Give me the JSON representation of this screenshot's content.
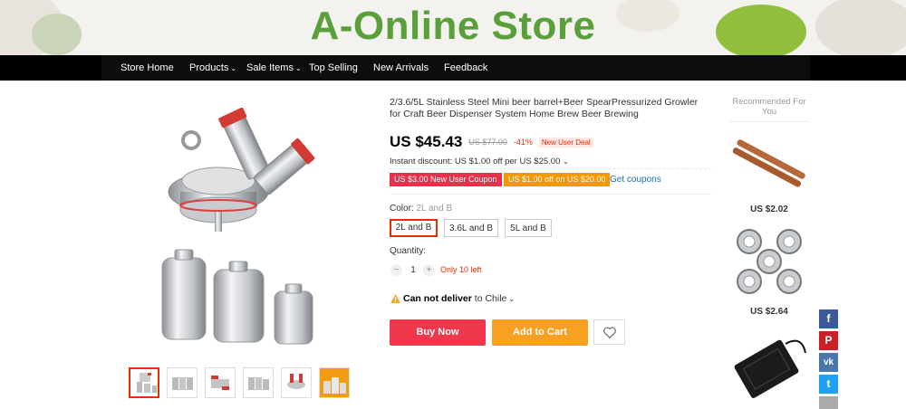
{
  "banner": {
    "title": "A-Online Store"
  },
  "nav": {
    "items": [
      {
        "label": "Store Home"
      },
      {
        "label": "Products"
      },
      {
        "label": "Sale Items"
      },
      {
        "label": "Top Selling"
      },
      {
        "label": "New Arrivals"
      },
      {
        "label": "Feedback"
      }
    ]
  },
  "product": {
    "title": "2/3.6/5L Stainless Steel Mini beer barrel+Beer SpearPressurized Growler for Craft Beer Dispenser System Home Brew Beer Brewing",
    "price": "US $45.43",
    "old_price": "US $77.00",
    "discount": "-41%",
    "deal_badge": "New User Deal",
    "instant_discount": "Instant discount: US $1.00 off per US $25.00",
    "coupons": [
      {
        "label": "US $3.00 New User Coupon"
      },
      {
        "label": "US $1.00 off on US $20.00"
      }
    ],
    "get_coupons": "Get coupons",
    "color_label": "Color:",
    "color_value": "2L and B",
    "color_options": [
      {
        "label": "2L and B",
        "selected": true
      },
      {
        "label": "3.6L and B",
        "selected": false
      },
      {
        "label": "5L and B",
        "selected": false
      }
    ],
    "quantity_label": "Quantity:",
    "quantity_value": "1",
    "stock_text": "Only 10 left",
    "deliver_bold": "Can not deliver",
    "deliver_rest": "to Chile",
    "buy_now": "Buy Now",
    "add_to_cart": "Add to Cart"
  },
  "recommended": {
    "title": "Recommended For You",
    "items": [
      {
        "price": "US $2.02",
        "icon": "wooden-tongs"
      },
      {
        "price": "US $2.64",
        "icon": "steel-rings"
      },
      {
        "icon": "heating-pad"
      }
    ]
  },
  "share": [
    {
      "icon": "facebook-icon",
      "glyph": "f",
      "color": "#3b5998"
    },
    {
      "icon": "pinterest-icon",
      "glyph": "P",
      "color": "#cb2027"
    },
    {
      "icon": "vk-icon",
      "glyph": "vk",
      "color": "#4a76a8"
    },
    {
      "icon": "twitter-icon",
      "glyph": "t",
      "color": "#1da1f2"
    }
  ],
  "colors": {
    "accent": "#e62e04",
    "buy": "#f0374c",
    "cart": "#f7a021",
    "brand_green": "#5aa03a"
  }
}
